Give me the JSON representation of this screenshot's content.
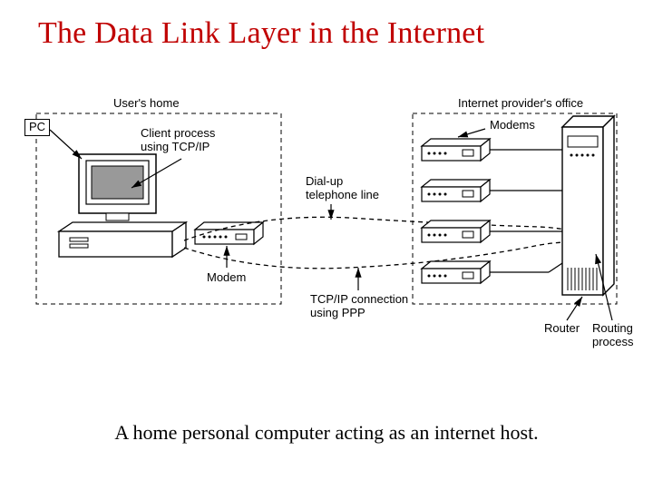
{
  "title": "The Data Link Layer in the Internet",
  "caption": "A home personal computer acting as an internet host.",
  "labels": {
    "users_home": "User's home",
    "isp_office": "Internet provider's office",
    "pc": "PC",
    "client_process": "Client process\nusing TCP/IP",
    "modem_left": "Modem",
    "dialup": "Dial-up\ntelephone line",
    "tcpip_ppp": "TCP/IP connection\nusing PPP",
    "modems": "Modems",
    "router": "Router",
    "routing_process": "Routing\nprocess"
  }
}
